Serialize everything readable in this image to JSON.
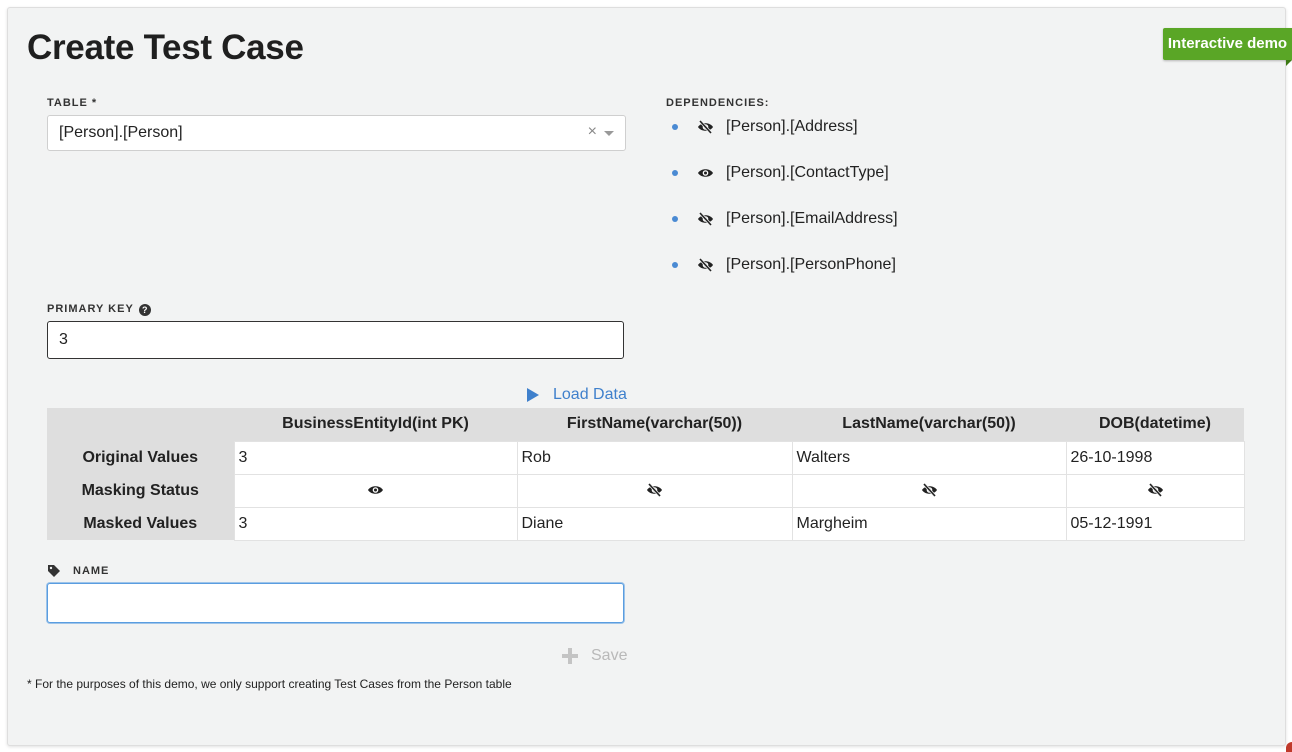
{
  "page": {
    "title": "Create Test Case",
    "badge": "Interactive demo",
    "footnote": "* For the purposes of this demo, we only support creating Test Cases from the Person table"
  },
  "colors": {
    "accent": "#3f80cc",
    "badge": "#5aa626",
    "panel_bg": "#f2f3f3",
    "header_bg": "#dedede"
  },
  "table_field": {
    "label": "TABLE *",
    "value": "[Person].[Person]",
    "clear_icon": "clear-icon",
    "clear_glyph": "×",
    "dropdown_icon": "chevron-down-icon"
  },
  "dependencies": {
    "label": "DEPENDENCIES:",
    "items": [
      {
        "text": "[Person].[Address]",
        "icon": "eye-slash-icon",
        "masked": true
      },
      {
        "text": "[Person].[ContactType]",
        "icon": "eye-icon",
        "masked": false
      },
      {
        "text": "[Person].[EmailAddress]",
        "icon": "eye-slash-icon",
        "masked": true
      },
      {
        "text": "[Person].[PersonPhone]",
        "icon": "eye-slash-icon",
        "masked": true
      }
    ]
  },
  "primary_key": {
    "label": "PRIMARY KEY",
    "help_icon": "help-icon",
    "help_glyph": "?",
    "value": "3"
  },
  "load_data": {
    "label": "Load Data",
    "icon": "play-icon"
  },
  "preview_table": {
    "columns": [
      "BusinessEntityId(int PK)",
      "FirstName(varchar(50))",
      "LastName(varchar(50))",
      "DOB(datetime)"
    ],
    "rows": [
      {
        "label": "Original Values",
        "cells": [
          "3",
          "Rob",
          "Walters",
          "26-10-1998"
        ]
      },
      {
        "label": "Masking Status",
        "icons": [
          "eye-icon",
          "eye-slash-icon",
          "eye-slash-icon",
          "eye-slash-icon"
        ]
      },
      {
        "label": "Masked Values",
        "cells": [
          "3",
          "Diane",
          "Margheim",
          "05-12-1991"
        ]
      }
    ]
  },
  "name_field": {
    "label": "NAME",
    "icon": "tag-icon",
    "value": "",
    "placeholder": ""
  },
  "save": {
    "label": "Save",
    "icon": "plus-icon"
  }
}
